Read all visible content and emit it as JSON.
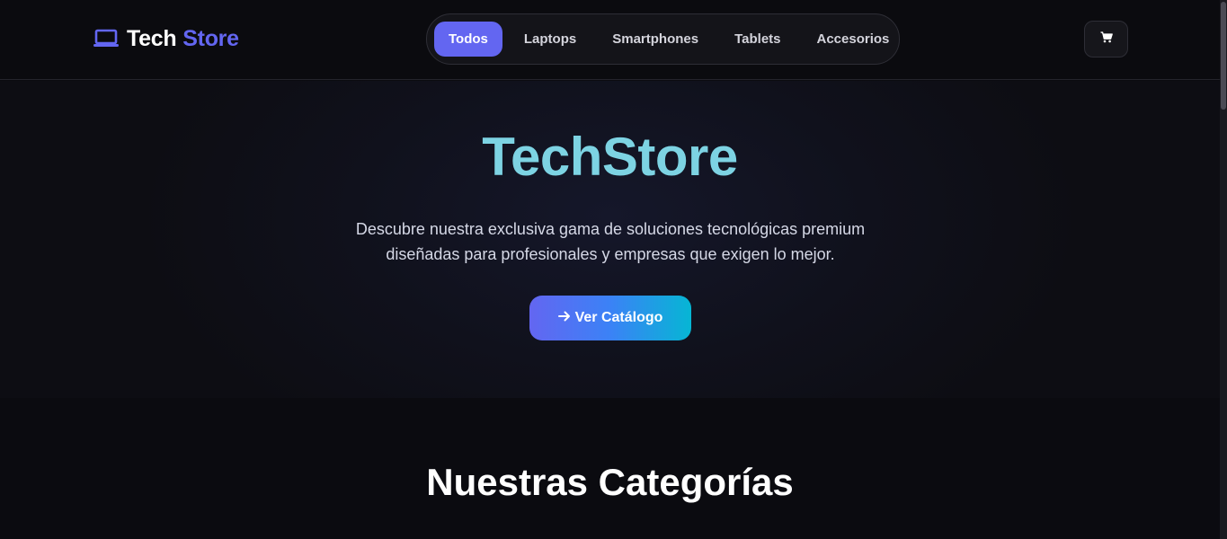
{
  "header": {
    "logo": {
      "word1": "Tech",
      "word2": "Store",
      "icon": "laptop-icon",
      "accent": "#6366f1"
    },
    "nav": [
      {
        "label": "Todos",
        "active": true
      },
      {
        "label": "Laptops",
        "active": false
      },
      {
        "label": "Smartphones",
        "active": false
      },
      {
        "label": "Tablets",
        "active": false
      },
      {
        "label": "Accesorios",
        "active": false
      }
    ],
    "cart_icon": "cart-icon"
  },
  "hero": {
    "title": "TechStore",
    "description_line1": "Descubre nuestra exclusiva gama de soluciones tecnológicas premium",
    "description_line2": "diseñadas para profesionales y empresas que exigen lo mejor.",
    "cta_label": "Ver Catálogo",
    "cta_icon": "arrow-right-icon"
  },
  "sections": {
    "categories_title": "Nuestras Categorías"
  },
  "colors": {
    "accent": "#6366f1",
    "title_cyan": "#7dd3e3",
    "gradient_end": "#06b6d4",
    "background": "#0b0b10"
  }
}
